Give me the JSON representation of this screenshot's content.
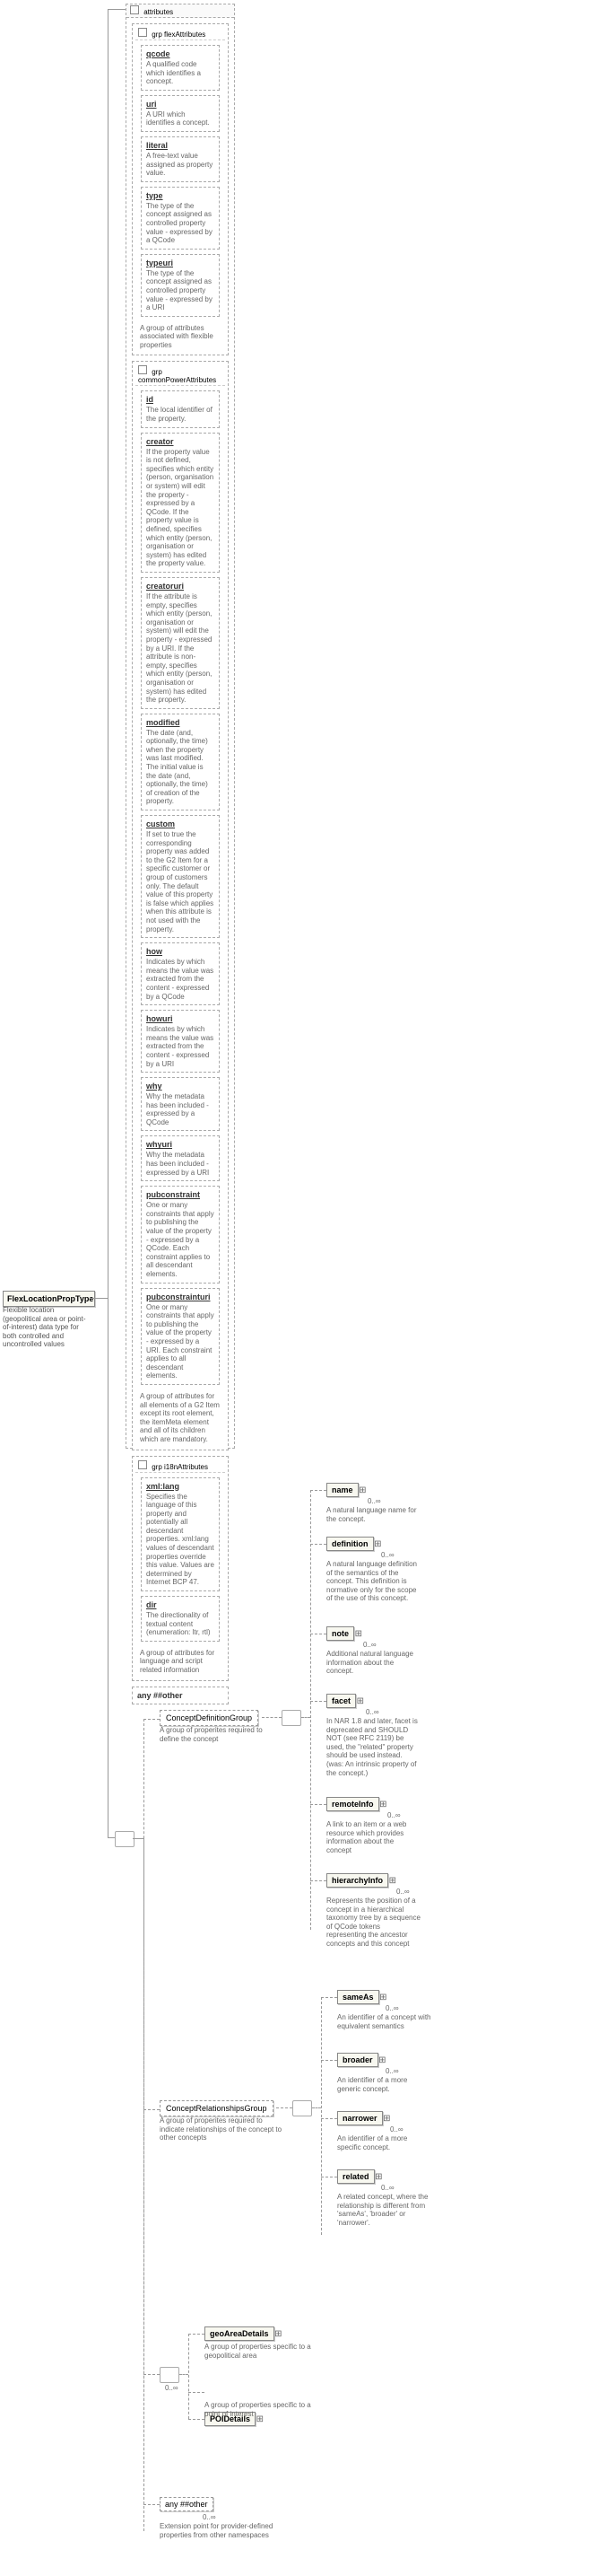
{
  "root": {
    "name": "FlexLocationPropType",
    "desc": "Flexible location (geopolitical area or point-of-interest) data type for both controlled and uncontrolled values"
  },
  "attr_container_label": "attributes",
  "flex": {
    "header": "grp  flexAttributes",
    "footer_desc": "A group of attributes associated with flexible properties",
    "items": [
      {
        "name": "qcode",
        "desc": "A qualified code which identifies a concept."
      },
      {
        "name": "uri",
        "desc": "A URI which identifies a concept."
      },
      {
        "name": "literal",
        "desc": "A free-text value assigned as property value."
      },
      {
        "name": "type",
        "desc": "The type of the concept assigned as controlled property value - expressed by a QCode"
      },
      {
        "name": "typeuri",
        "desc": "The type of the concept assigned as controlled property value - expressed by a URI"
      }
    ]
  },
  "common": {
    "header": "grp  commonPowerAttributes",
    "footer_desc": "A group of attributes for all elements of a G2 Item except its root element, the itemMeta element and all of its children which are mandatory.",
    "items": [
      {
        "name": "id",
        "desc": "The local identifier of the property."
      },
      {
        "name": "creator",
        "desc": "If the property value is not defined, specifies which entity (person, organisation or system) will edit the property - expressed by a QCode. If the property value is defined, specifies which entity (person, organisation or system) has edited the property value."
      },
      {
        "name": "creatoruri",
        "desc": "If the attribute is empty, specifies which entity (person, organisation or system) will edit the property - expressed by a URI. If the attribute is non-empty, specifies which entity (person, organisation or system) has edited the property."
      },
      {
        "name": "modified",
        "desc": "The date (and, optionally, the time) when the property was last modified. The initial value is the date (and, optionally, the time) of creation of the property."
      },
      {
        "name": "custom",
        "desc": "If set to true the corresponding property was added to the G2 Item for a specific customer or group of customers only. The default value of this property is false which applies when this attribute is not used with the property."
      },
      {
        "name": "how",
        "desc": "Indicates by which means the value was extracted from the content - expressed by a QCode"
      },
      {
        "name": "howuri",
        "desc": "Indicates by which means the value was extracted from the content - expressed by a URI"
      },
      {
        "name": "why",
        "desc": "Why the metadata has been included - expressed by a QCode"
      },
      {
        "name": "whyuri",
        "desc": "Why the metadata has been included - expressed by a URI"
      },
      {
        "name": "pubconstraint",
        "desc": "One or many constraints that apply to publishing the value of the property - expressed by a QCode. Each constraint applies to all descendant elements."
      },
      {
        "name": "pubconstrainturi",
        "desc": "One or many constraints that apply to publishing the value of the property - expressed by a URI. Each constraint applies to all descendant elements."
      }
    ]
  },
  "i18n": {
    "header": "grp  i18nAttributes",
    "footer_desc": "A group of attributes for language and script related information",
    "items": [
      {
        "name": "xml:lang",
        "desc": "Specifies the language of this property and potentially all descendant properties. xml:lang values of descendant properties override this value. Values are determined by Internet BCP 47."
      },
      {
        "name": "dir",
        "desc": "The directionality of textual content (enumeration: ltr, rtl)"
      }
    ]
  },
  "any_other_attr": "any  ##other",
  "cdg": {
    "label": "ConceptDefinitionGroup",
    "desc": "A group of properites required to define the concept",
    "items": [
      {
        "name": "name",
        "desc": "A natural language name for the concept."
      },
      {
        "name": "definition",
        "desc": "A natural language definition of the semantics of the concept. This definition is normative only for the scope of the use of this concept."
      },
      {
        "name": "note",
        "desc": "Additional natural language information about the concept."
      },
      {
        "name": "facet",
        "desc": "In NAR 1.8 and later, facet is deprecated and SHOULD NOT (see RFC 2119) be used, the \"related\" property should be used instead. (was: An intrinsic property of the concept.)"
      },
      {
        "name": "remoteInfo",
        "desc": "A link to an item or a web resource which provides information about the concept"
      },
      {
        "name": "hierarchyInfo",
        "desc": "Represents the position of a concept in a hierarchical taxonomy tree by a sequence of QCode tokens representing the ancestor concepts and this concept"
      }
    ]
  },
  "crg": {
    "label": "ConceptRelationshipsGroup",
    "desc": "A group of properites required to indicate relationships of the concept to other concepts",
    "items": [
      {
        "name": "sameAs",
        "desc": "An identifier of a concept with equivalent semantics"
      },
      {
        "name": "broader",
        "desc": "An identifier of a more generic concept."
      },
      {
        "name": "narrower",
        "desc": "An identifier of a more specific concept."
      },
      {
        "name": "related",
        "desc": "A related concept, where the relationship is different from 'sameAs', 'broader' or 'narrower'."
      }
    ]
  },
  "geo": {
    "name": "geoAreaDetails",
    "desc": "A group of properties specific to a geopolitical area"
  },
  "poi": {
    "name": "POIDetails",
    "desc": "A group of properties specific to a point of interest"
  },
  "any_other_elem": {
    "label": "any  ##other",
    "desc": "Extension point for provider-defined properties from other namespaces"
  },
  "card_0inf": "0..∞"
}
